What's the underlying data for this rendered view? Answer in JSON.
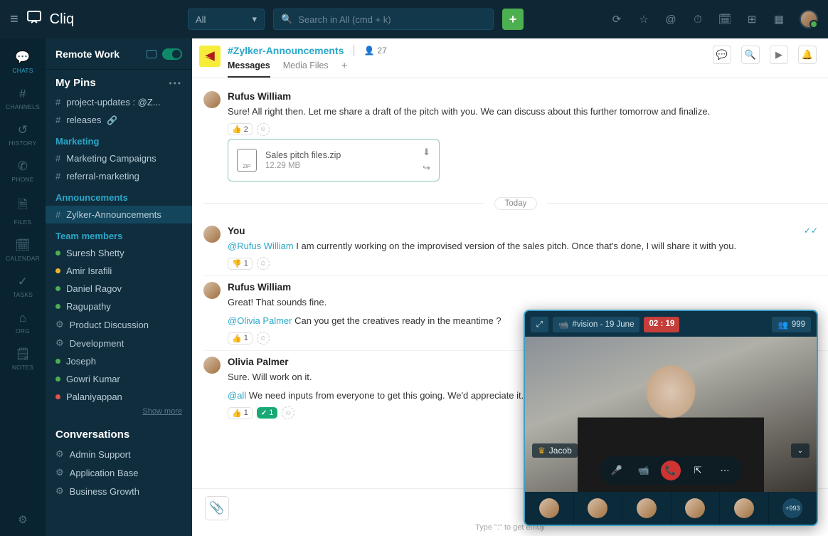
{
  "app": {
    "name": "Cliq"
  },
  "topbar": {
    "filter_all": "All",
    "search_placeholder": "Search in All (cmd + k)"
  },
  "rail": [
    {
      "icon": "💬",
      "label": "CHATS",
      "active": true
    },
    {
      "icon": "#",
      "label": "CHANNELS"
    },
    {
      "icon": "↺",
      "label": "HISTORY"
    },
    {
      "icon": "✆",
      "label": "PHONE"
    },
    {
      "icon": "🗎",
      "label": "FILES"
    },
    {
      "icon": "🗓",
      "label": "CALENDAR"
    },
    {
      "icon": "✓",
      "label": "TASKS"
    },
    {
      "icon": "⌂",
      "label": "ORG"
    },
    {
      "icon": "🗒",
      "label": "NOTES"
    }
  ],
  "workspace": {
    "name": "Remote Work"
  },
  "pins": {
    "title": "My Pins",
    "items": [
      {
        "label": "project-updates : @Z..."
      },
      {
        "label": "releases",
        "linked": true
      }
    ]
  },
  "sections": {
    "marketing": {
      "title": "Marketing",
      "items": [
        {
          "label": "Marketing Campaigns"
        },
        {
          "label": "referral-marketing"
        }
      ]
    },
    "announcements": {
      "title": "Announcements",
      "items": [
        {
          "label": "Zylker-Announcements",
          "selected": true
        }
      ]
    },
    "team": {
      "title": "Team members",
      "show_more": "Show more",
      "items": [
        {
          "dot": "green",
          "label": "Suresh Shetty"
        },
        {
          "dot": "yellow",
          "label": "Amir Israfili"
        },
        {
          "dot": "green",
          "label": "Daniel Ragov"
        },
        {
          "dot": "green",
          "label": "Ragupathy"
        },
        {
          "dot": "",
          "label": "Product Discussion",
          "gear": true
        },
        {
          "dot": "",
          "label": "Development",
          "gear": true
        },
        {
          "dot": "green",
          "label": "Joseph"
        },
        {
          "dot": "green",
          "label": "Gowri Kumar"
        },
        {
          "dot": "red",
          "label": "Palaniyappan"
        }
      ]
    },
    "conversations": {
      "title": "Conversations",
      "items": [
        {
          "label": "Admin Support",
          "gear": true
        },
        {
          "label": "Application Base",
          "gear": true
        },
        {
          "label": "Business Growth",
          "gear": true
        }
      ]
    }
  },
  "channel": {
    "title": "#Zylker-Announcements",
    "member_count": "27",
    "tabs": [
      {
        "label": "Messages",
        "active": true
      },
      {
        "label": "Media Files"
      }
    ]
  },
  "messages": [
    {
      "author": "Rufus William",
      "text": "Sure! All right then. Let me share a draft of the pitch with you. We can discuss about this further tomorrow and finalize.",
      "reactions": [
        {
          "type": "thumb",
          "count": "2"
        }
      ],
      "file": {
        "name": "Sales pitch files.zip",
        "size": "12.29 MB"
      }
    },
    {
      "divider": "Today"
    },
    {
      "author": "You",
      "mention": "@Rufus William",
      "text": "I am currently working on the improvised version of the sales pitch. Once that's done, I will share it with you.",
      "reactions": [
        {
          "type": "down",
          "count": "1"
        }
      ],
      "checks": true
    },
    {
      "author": "Rufus William",
      "text": "Great! That sounds fine.",
      "mention": "@Olivia Palmer",
      "text2": "Can you get the creatives ready in the meantime ?",
      "reactions": [
        {
          "type": "thumb",
          "count": "1"
        }
      ]
    },
    {
      "author": "Olivia Palmer",
      "text": "Sure. Will work on it.",
      "mention": "@all",
      "text2": "We need inputs from everyone to get this going. We'd appreciate it.",
      "reactions": [
        {
          "type": "thumb",
          "count": "1"
        },
        {
          "type": "check",
          "count": "1"
        }
      ]
    }
  ],
  "composer": {
    "hint": "Type \":\" to get emoji"
  },
  "video": {
    "channel": "#vision - 19 June",
    "time": "02 : 19",
    "participants": "999",
    "presenter": "Jacob",
    "more": "+993"
  }
}
